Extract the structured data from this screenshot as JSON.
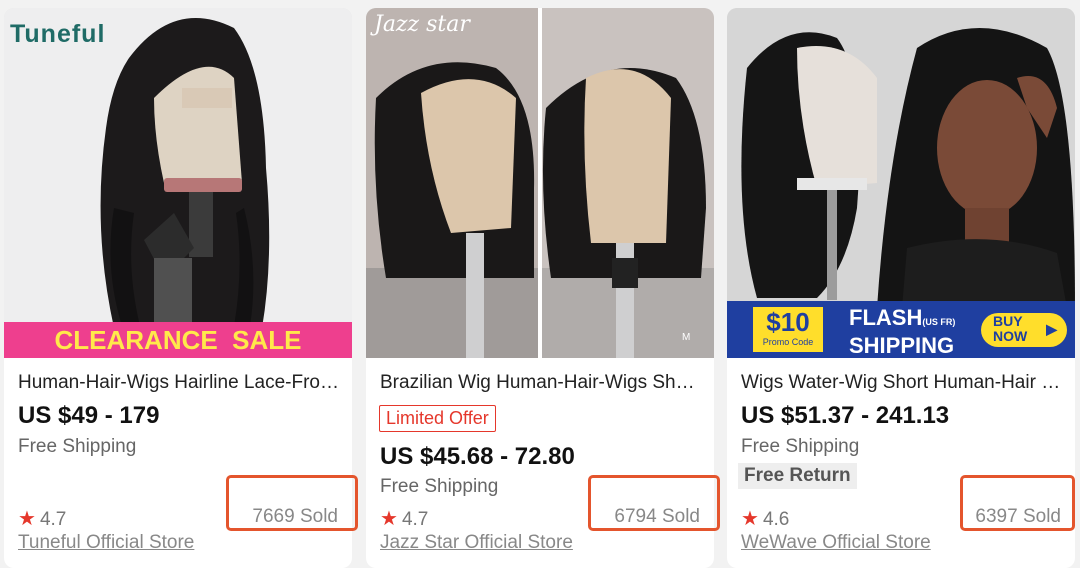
{
  "products": [
    {
      "brand_logo": "Tuneful",
      "banner": "CLEARANCE  SALE",
      "title": "Human-Hair-Wigs Hairline Lace-Front Wigs",
      "price": "US $49 - 179",
      "shipping": "Free Shipping",
      "rating": "4.7",
      "sold": "7669 Sold",
      "store": "Tuneful Official Store"
    },
    {
      "brand_logo": "Jazz star",
      "image_mark": "M",
      "title": "Brazilian Wig Human-Hair-Wigs Short Bob",
      "badge": "Limited Offer",
      "price": "US $45.68 - 72.80",
      "shipping": "Free Shipping",
      "rating": "4.7",
      "sold": "6794 Sold",
      "store": "Jazz Star Official Store"
    },
    {
      "promo_amount": "$10",
      "promo_code": "Promo Code",
      "flash_line1": "FLASH",
      "flash_note": "(US FR)",
      "flash_line2": "SHIPPING",
      "buy_now": "BUY NOW",
      "title": "Wigs Water-Wig Short Human-Hair Lace",
      "price": "US $51.37 - 241.13",
      "shipping": "Free Shipping",
      "free_return": "Free Return",
      "rating": "4.6",
      "sold": "6397 Sold",
      "store": "WeWave Official Store"
    }
  ],
  "colors": {
    "accent": "#e5372b",
    "highlight": "#e4552d",
    "pink_banner": "#ee3f8e",
    "flash_blue": "#1f3fa0"
  },
  "icons": {
    "rating": "star-icon",
    "buy": "play-arrow-icon"
  }
}
